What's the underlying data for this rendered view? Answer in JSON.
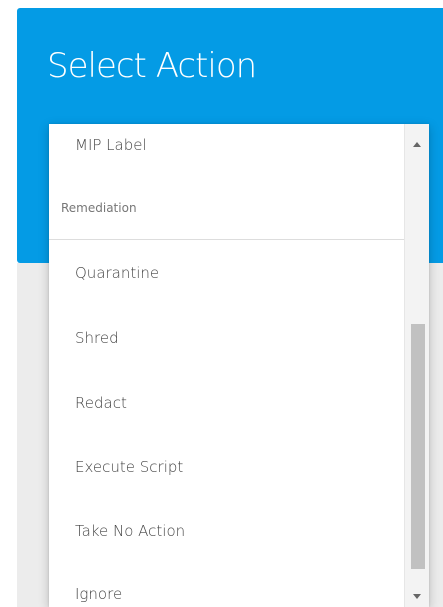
{
  "header": {
    "title": "Select Action"
  },
  "dropdown": {
    "items_above": [
      {
        "label": "MIP Label"
      }
    ],
    "group_header": "Remediation",
    "items": [
      {
        "label": "Quarantine"
      },
      {
        "label": "Shred"
      },
      {
        "label": "Redact"
      },
      {
        "label": "Execute Script"
      },
      {
        "label": "Take No Action"
      },
      {
        "label": "Ignore"
      }
    ]
  },
  "colors": {
    "header_background": "#049be5",
    "lower_panel_background": "#ececec",
    "item_text": "#444444",
    "scrollbar_thumb": "#c1c1c1"
  },
  "icons": {
    "scroll_up": "scroll-up-arrow-icon",
    "scroll_down": "scroll-down-arrow-icon"
  }
}
